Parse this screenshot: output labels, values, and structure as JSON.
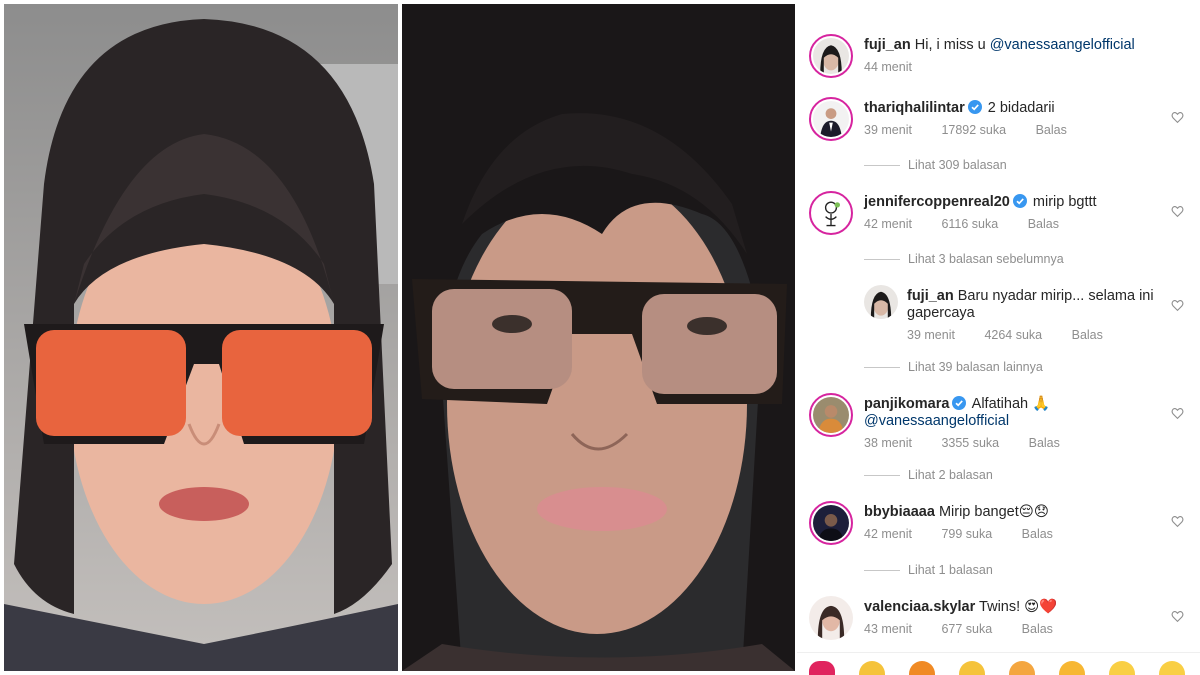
{
  "caption": {
    "username": "fuji_an",
    "text": "Hi, i miss u",
    "mention": "@vanessaangelofficial",
    "time": "44 menit"
  },
  "comments": [
    {
      "username": "thariqhalilintar",
      "verified": true,
      "text": "2 bidadarii",
      "time": "39 menit",
      "likes": "17892 suka",
      "reply_label": "Balas",
      "view_replies": "Lihat 309 balasan"
    },
    {
      "username": "jennifercoppenreal20",
      "verified": true,
      "text": "mirip bgttt",
      "time": "42 menit",
      "likes": "6116 suka",
      "reply_label": "Balas",
      "view_prev_replies": "Lihat 3 balasan sebelumnya",
      "reply": {
        "username": "fuji_an",
        "text": "Baru nyadar mirip... selama ini gapercaya",
        "time": "39 menit",
        "likes": "4264 suka",
        "reply_label": "Balas"
      },
      "view_replies": "Lihat 39 balasan lainnya"
    },
    {
      "username": "panjikomara",
      "verified": true,
      "text": "Alfatihah 🙏",
      "mention": "@vanessaangelofficial",
      "time": "38 menit",
      "likes": "3355 suka",
      "reply_label": "Balas",
      "view_replies": "Lihat 2 balasan"
    },
    {
      "username": "bbybiaaaa",
      "verified": false,
      "text": "Mirip banget😔😞",
      "time": "42 menit",
      "likes": "799 suka",
      "reply_label": "Balas",
      "view_replies": "Lihat 1 balasan"
    },
    {
      "username": "valenciaa.skylar",
      "verified": false,
      "text": "Twins! 😍❤️",
      "time": "43 menit",
      "likes": "677 suka",
      "reply_label": "Balas"
    }
  ],
  "emoji_bar": [
    "heart",
    "clap",
    "fire",
    "raised-hands",
    "crying-laughing",
    "heart-eyes",
    "surprised",
    "laughing"
  ],
  "colors": {
    "mention": "#00376b",
    "meta_gray": "#8e8e8e",
    "verified_blue": "#3897f0",
    "story_ring": "#d6249f"
  }
}
